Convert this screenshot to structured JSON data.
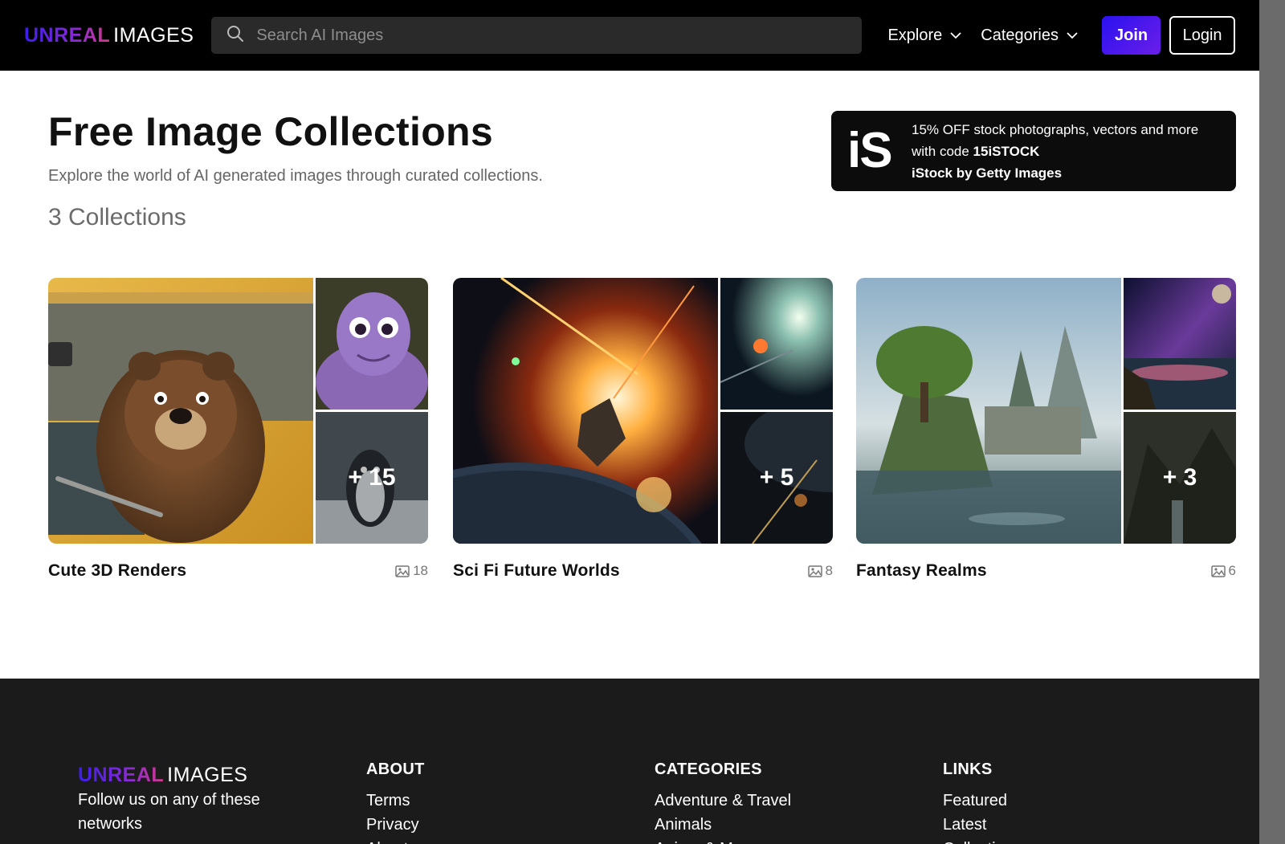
{
  "header": {
    "logo_part1": "UNREAL",
    "logo_part2": "IMAGES",
    "search_placeholder": "Search AI Images",
    "nav": [
      {
        "label": "Explore"
      },
      {
        "label": "Categories"
      }
    ],
    "join_label": "Join",
    "login_label": "Login"
  },
  "hero": {
    "title": "Free Image Collections",
    "subtitle": "Explore the world of AI generated images through curated collections.",
    "count": "3 Collections"
  },
  "promo": {
    "logo": "iS",
    "line1": "15% OFF stock photographs, vectors and more",
    "line2_prefix": "with code ",
    "code": "15iSTOCK",
    "line3": "iStock by Getty Images"
  },
  "collections": [
    {
      "title": "Cute 3D Renders",
      "more": "+ 15",
      "count": "18"
    },
    {
      "title": "Sci Fi Future Worlds",
      "more": "+ 5",
      "count": "8"
    },
    {
      "title": "Fantasy Realms",
      "more": "+ 3",
      "count": "6"
    }
  ],
  "footer": {
    "logo_part1": "UNREAL",
    "logo_part2": "IMAGES",
    "follow": "Follow us on any of these networks",
    "columns": [
      {
        "heading": "ABOUT",
        "links": [
          "Terms",
          "Privacy",
          "About"
        ]
      },
      {
        "heading": "CATEGORIES",
        "links": [
          "Adventure & Travel",
          "Animals",
          "Anime & Manga"
        ]
      },
      {
        "heading": "LINKS",
        "links": [
          "Featured",
          "Latest",
          "Collections"
        ]
      }
    ]
  },
  "colors": {
    "accent": "#2a12f0",
    "header_bg": "#000000",
    "footer_bg": "#1b1b1b"
  },
  "icons": {
    "search": "search-icon",
    "chevron": "chevron-down-icon",
    "image_count": "image-icon"
  }
}
